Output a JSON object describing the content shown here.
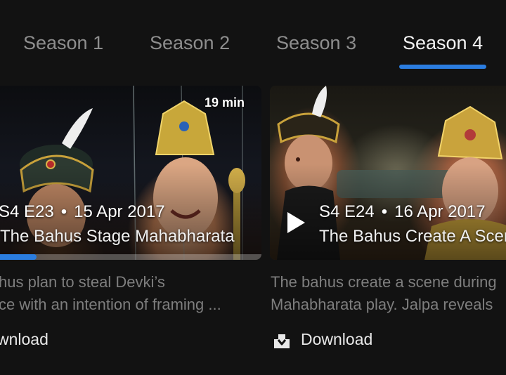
{
  "tabs": [
    {
      "label": "Season 1",
      "active": false
    },
    {
      "label": "Season 2",
      "active": false
    },
    {
      "label": "Season 3",
      "active": false
    },
    {
      "label": "Season 4",
      "active": true
    }
  ],
  "episodes": [
    {
      "code": "S4 E23",
      "separator": "•",
      "date": "15 Apr 2017",
      "title": "The Bahus Stage Mahabharata",
      "duration": "19 min",
      "progress_fraction": 0.14,
      "description_lines": [
        "hus plan to steal Devki’s",
        "ce with an intention of framing ..."
      ],
      "download_label": "wnload"
    },
    {
      "code": "S4 E24",
      "separator": "•",
      "date": "16 Apr 2017",
      "title": "The Bahus Create A Scen",
      "description_lines": [
        "The bahus create a scene during",
        "Mahabharata play. Jalpa reveals"
      ],
      "download_label": "Download",
      "play_icon": "play-icon",
      "download_icon": "download-icon"
    }
  ],
  "colors": {
    "accent": "#2b7de0",
    "background": "#121212",
    "muted_text": "#7e7e7e"
  }
}
